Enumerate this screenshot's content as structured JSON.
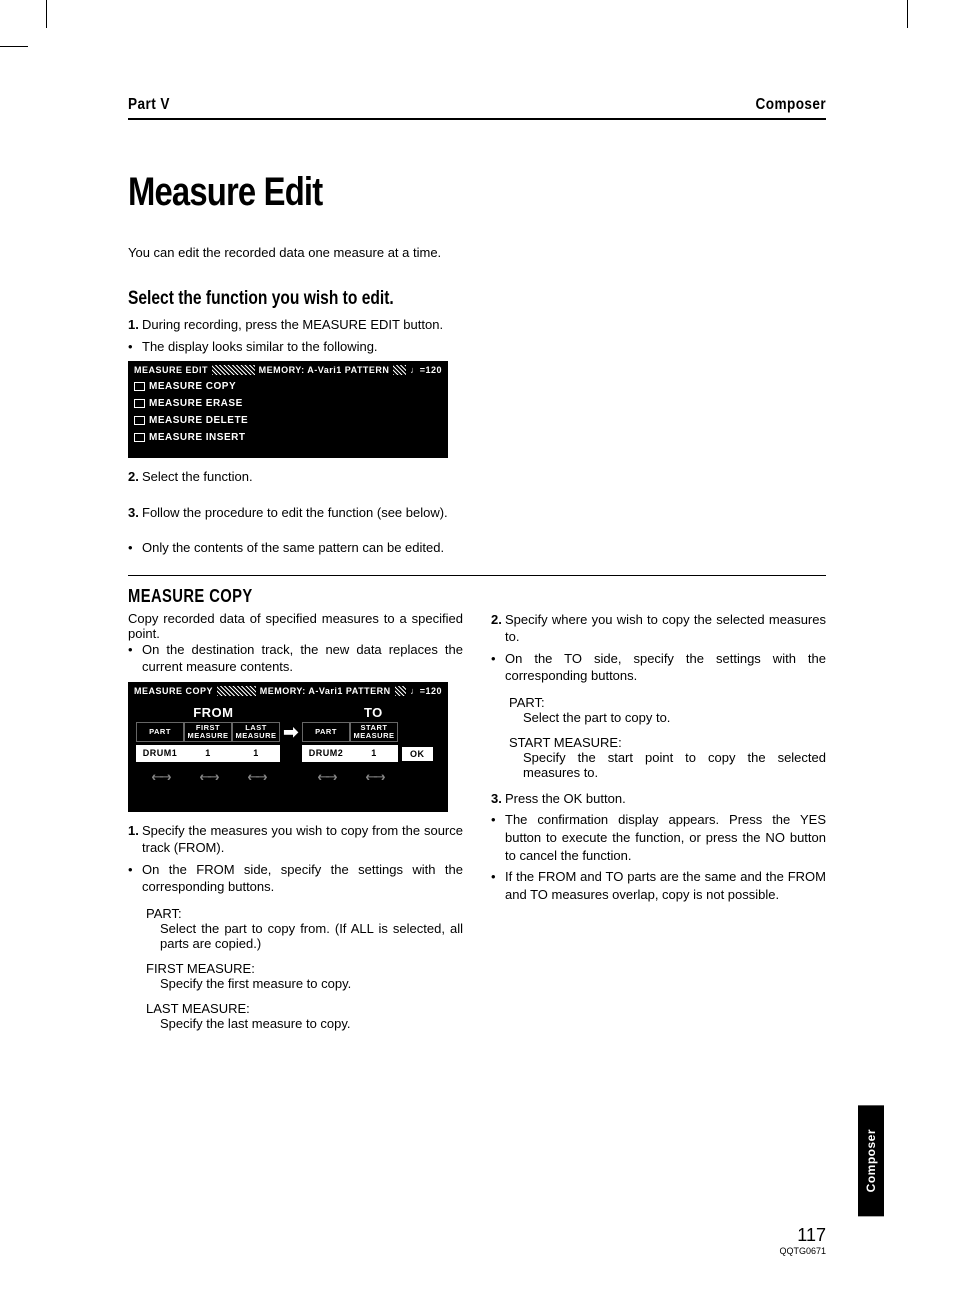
{
  "header": {
    "left": "Part V",
    "right": "Composer"
  },
  "title": "Measure Edit",
  "intro": "You can edit the recorded data one measure at a time.",
  "sectionA": {
    "heading": "Select the function you wish to edit.",
    "step1": "During recording, press the MEASURE EDIT button.",
    "bullet1": "The display looks similar to the following.",
    "screen": {
      "title": "MEASURE EDIT",
      "memory": "MEMORY: A-Vari1 PATTERN",
      "tempo": "♩=120",
      "items": [
        "MEASURE COPY",
        "MEASURE ERASE",
        "MEASURE DELETE",
        "MEASURE INSERT"
      ]
    },
    "step2": "Select the function.",
    "step3": "Follow the procedure to edit the function (see below).",
    "bullet2": "Only the contents of the same pattern can be edited."
  },
  "sectionB": {
    "heading": "MEASURE COPY",
    "intro": "Copy recorded data of specified measures to a specified point.",
    "bullet1": "On the destination track, the new data re­places the current measure contents.",
    "screen": {
      "title": "MEASURE COPY",
      "memory": "MEMORY: A-Vari1 PATTERN",
      "tempo": "♩=120",
      "from": "FROM",
      "to": "TO",
      "headers": {
        "part": "PART",
        "first": "FIRST MEASURE",
        "last": "LAST MEASURE",
        "start": "START MEASURE"
      },
      "values": {
        "fromPart": "DRUM1",
        "fromFirst": "1",
        "fromLast": "1",
        "toPart": "DRUM2",
        "toStart": "1"
      },
      "ok": "OK"
    },
    "step1": "Specify the measures you wish to copy from the source track (FROM).",
    "bullet2": "On the FROM side, specify the settings with the corresponding buttons.",
    "defs1": {
      "partLabel": "PART:",
      "partDesc": "Select the part to copy from. (If ALL is selected, all parts are copied.)",
      "firstLabel": "FIRST MEASURE:",
      "firstDesc": "Specify the first measure to copy.",
      "lastLabel": "LAST MEASURE:",
      "lastDesc": "Specify the last measure to copy."
    },
    "step2": "Specify where you wish to copy the selected measures to.",
    "bullet3": "On the TO side, specify the settings with the corresponding buttons.",
    "defs2": {
      "partLabel": "PART:",
      "partDesc": "Select the part to copy to.",
      "startLabel": "START MEASURE:",
      "startDesc": "Specify the start point to copy the selected measures to."
    },
    "step3": "Press the OK button.",
    "bullet4": "The confirmation display appears. Press the YES button to execute the function, or press the NO button to cancel the function.",
    "bullet5": "If the FROM and TO parts are the same and the FROM and TO measures overlap, copy is not possible."
  },
  "sideTab": "Composer",
  "footer": {
    "pageNum": "117",
    "code": "QQTG0671"
  }
}
